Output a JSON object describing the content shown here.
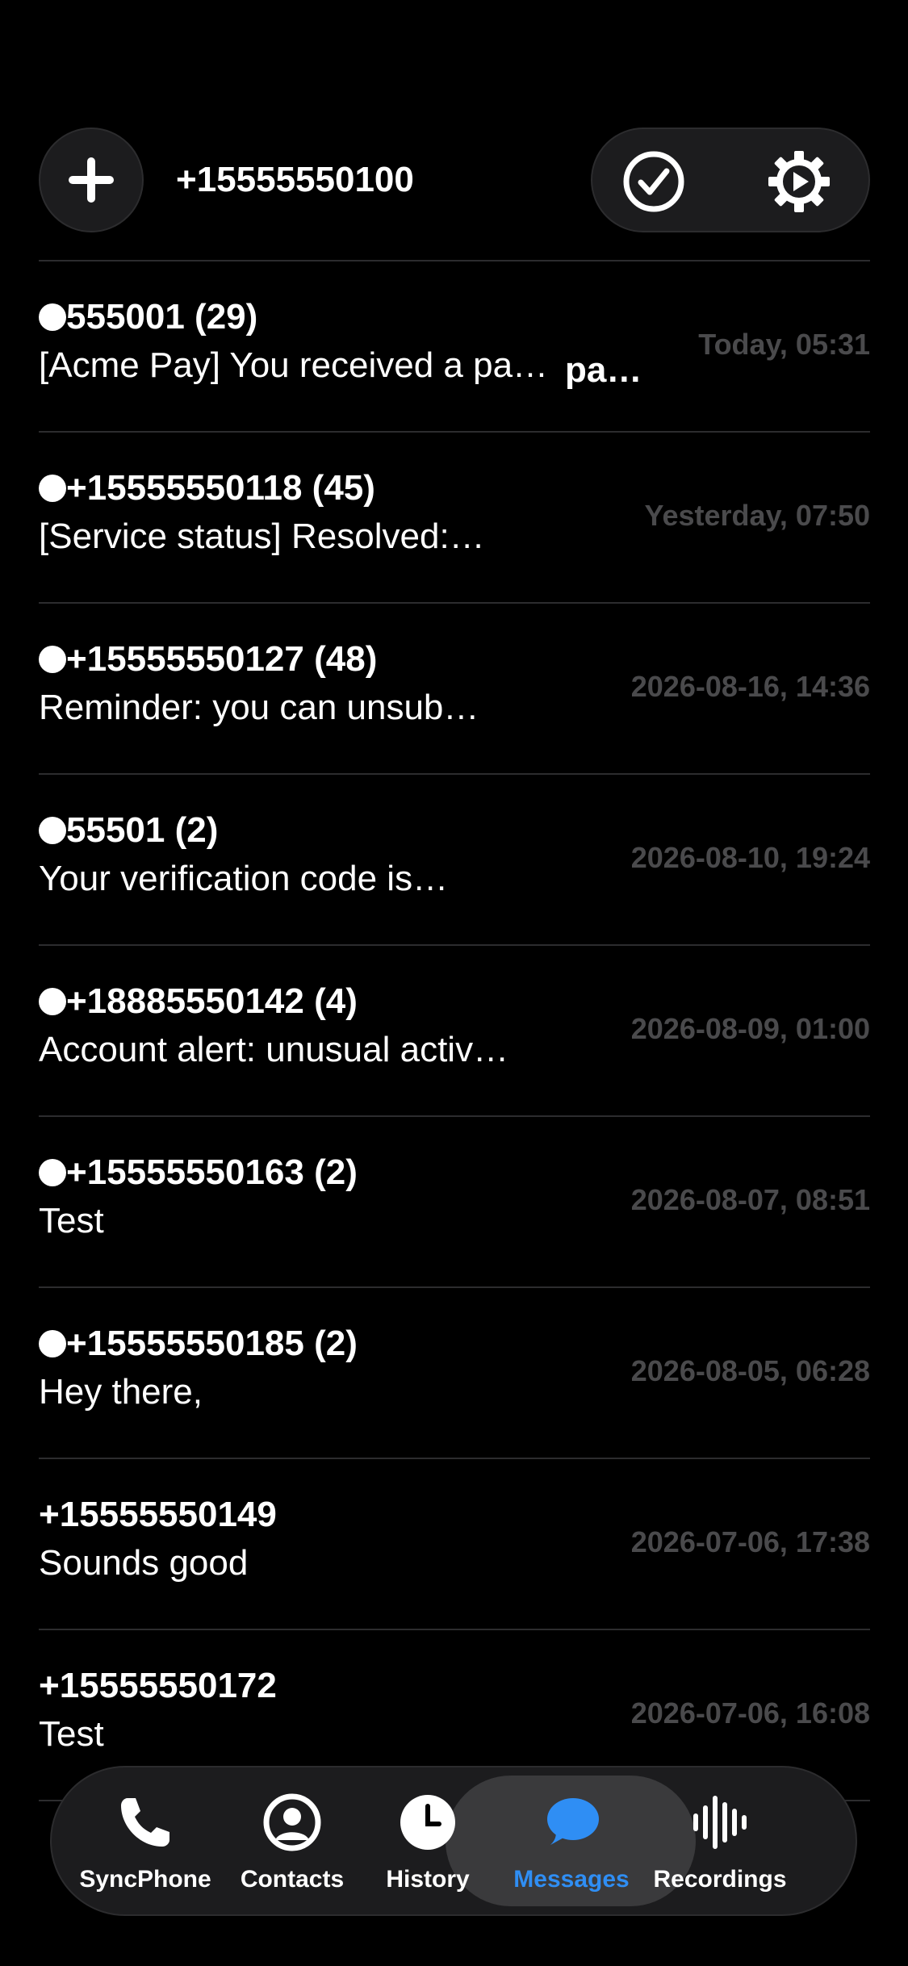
{
  "header": {
    "phone_number": "+15555550100",
    "add_icon": "plus-icon",
    "check_icon": "checkmark-circle-icon",
    "settings_icon": "gear-icon"
  },
  "conversations": [
    {
      "title": "555001 (29)",
      "unread": true,
      "preview": "[Acme Pay] You received a pa…",
      "extra": "pa…",
      "time": "Today, 05:31"
    },
    {
      "title": "+15555550118 (45)",
      "unread": true,
      "preview": "[Service status] Resolved:…",
      "extra": "",
      "time": "Yesterday, 07:50"
    },
    {
      "title": "+15555550127 (48)",
      "unread": true,
      "preview": "Reminder: you can unsub…",
      "extra": "",
      "time": "2026-08-16, 14:36"
    },
    {
      "title": "55501 (2)",
      "unread": true,
      "preview": "Your verification code is…",
      "extra": "",
      "time": "2026-08-10, 19:24"
    },
    {
      "title": "+18885550142 (4)",
      "unread": true,
      "preview": "Account alert: unusual activ…",
      "extra": "",
      "time": "2026-08-09, 01:00"
    },
    {
      "title": "+15555550163 (2)",
      "unread": true,
      "preview": "Test",
      "extra": "",
      "time": "2026-08-07, 08:51"
    },
    {
      "title": "+15555550185 (2)",
      "unread": true,
      "preview": "Hey there,",
      "extra": "",
      "time": "2026-08-05, 06:28"
    },
    {
      "title": "+15555550149",
      "unread": false,
      "preview": "Sounds good",
      "extra": "",
      "time": "2026-07-06, 17:38"
    },
    {
      "title": "+15555550172",
      "unread": false,
      "preview": "Test",
      "extra": "",
      "time": "2026-07-06, 16:08"
    }
  ],
  "tabbar": {
    "tabs": [
      {
        "label": "SyncPhone",
        "icon": "phone-icon"
      },
      {
        "label": "Contacts",
        "icon": "person-circle-icon"
      },
      {
        "label": "History",
        "icon": "clock-icon"
      },
      {
        "label": "Messages",
        "icon": "message-bubble-icon",
        "active": true
      },
      {
        "label": "Recordings",
        "icon": "waveform-icon"
      }
    ],
    "active_color": "#2f8ef4"
  }
}
